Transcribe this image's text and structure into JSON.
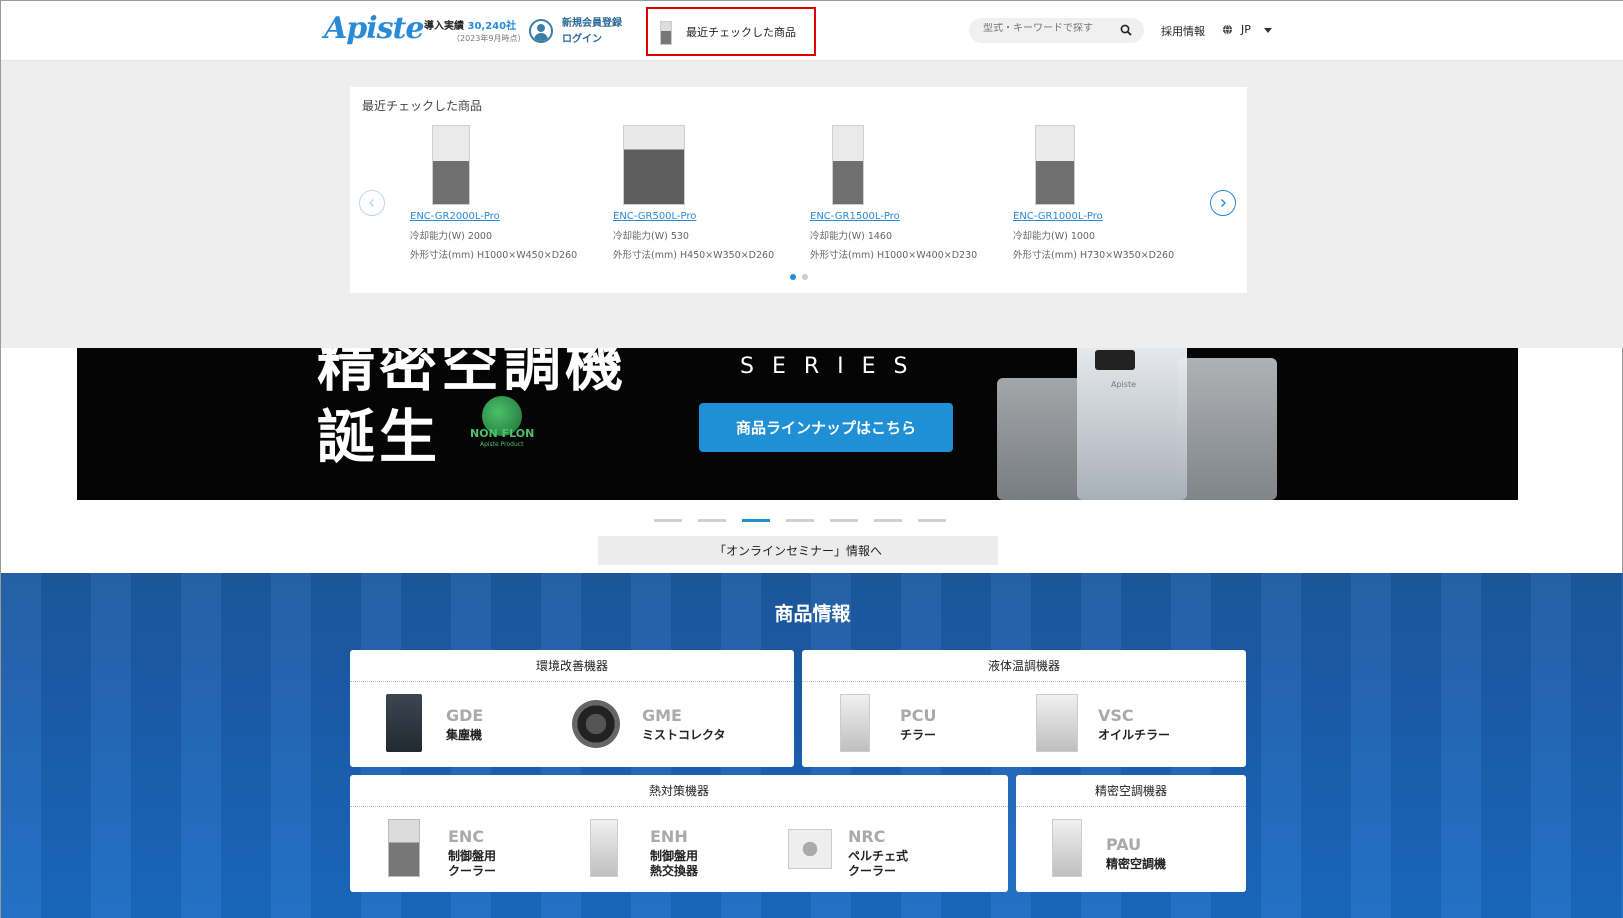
{
  "header": {
    "logo": "Apiste",
    "stats_label": "導入実績",
    "stats_count": "30,240社",
    "stats_note": "（2023年9月時点）",
    "member_register": "新規会員登録",
    "member_login": "ログイン",
    "recent_button": "最近チェックした商品",
    "search_placeholder": "型式・キーワードで探す",
    "recruit": "採用情報",
    "lang": "JP"
  },
  "recent": {
    "title": "最近チェックした商品",
    "items": [
      {
        "name": "ENC-GR2000L-Pro",
        "spec1": "冷却能力(W) 2000",
        "spec2": "外形寸法(mm) H1000×W450×D260"
      },
      {
        "name": "ENC-GR500L-Pro",
        "spec1": "冷却能力(W) 530",
        "spec2": "外形寸法(mm) H450×W350×D260"
      },
      {
        "name": "ENC-GR1500L-Pro",
        "spec1": "冷却能力(W) 1460",
        "spec2": "外形寸法(mm) H1000×W400×D230"
      },
      {
        "name": "ENC-GR1000L-Pro",
        "spec1": "冷却能力(W) 1000",
        "spec2": "外形寸法(mm) H730×W350×D260"
      }
    ],
    "page_count": 2,
    "active_page": 1
  },
  "hero": {
    "headline_clip": "精密空調機",
    "headline": "誕生",
    "badge_main": "NON FLON",
    "badge_sub": "Apiste Product",
    "series": "SERIES",
    "cta": "商品ラインナップはこちら",
    "unit_brand": "Apiste",
    "slide_count": 7,
    "active_slide": 3
  },
  "seminar_link": "「オンラインセミナー」情報へ",
  "products": {
    "title": "商品情報",
    "categories": [
      {
        "title": "環境改善機器",
        "items": [
          {
            "code": "GDE",
            "name": "集塵機"
          },
          {
            "code": "GME",
            "name": "ミストコレクタ"
          }
        ]
      },
      {
        "title": "液体温調機器",
        "items": [
          {
            "code": "PCU",
            "name": "チラー"
          },
          {
            "code": "VSC",
            "name": "オイルチラー"
          }
        ]
      },
      {
        "title": "熱対策機器",
        "items": [
          {
            "code": "ENC",
            "name1": "制御盤用",
            "name2": "クーラー"
          },
          {
            "code": "ENH",
            "name1": "制御盤用",
            "name2": "熱交換器"
          },
          {
            "code": "NRC",
            "name1": "ペルチェ式",
            "name2": "クーラー"
          }
        ]
      },
      {
        "title": "精密空調機器",
        "items": [
          {
            "code": "PAU",
            "name": "精密空調機"
          }
        ]
      }
    ]
  },
  "colors": {
    "brand": "#2a8ad8",
    "highlight": "#e00000",
    "cta": "#1f8fd6"
  }
}
